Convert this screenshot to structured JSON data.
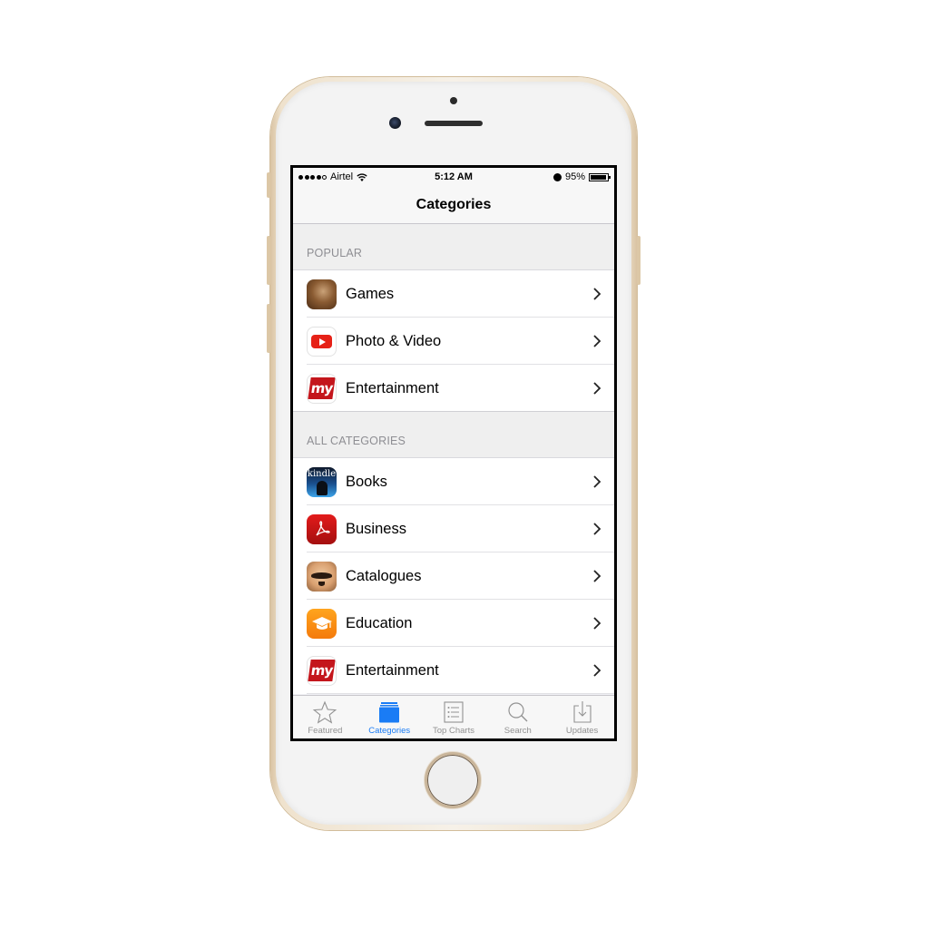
{
  "status_bar": {
    "carrier": "Airtel",
    "signal_bars_filled": 4,
    "signal_bars_total": 5,
    "time": "5:12 AM",
    "battery_percent": "95%",
    "battery_level": 0.95,
    "icons": [
      "signal-icon",
      "wifi-icon",
      "alarm-icon",
      "battery-icon"
    ]
  },
  "nav": {
    "title": "Categories"
  },
  "sections": [
    {
      "header": "POPULAR",
      "items": [
        {
          "label": "Games",
          "icon": "games-app-icon"
        },
        {
          "label": "Photo & Video",
          "icon": "youtube-app-icon"
        },
        {
          "label": "Entertainment",
          "icon": "bookmyshow-app-icon"
        }
      ]
    },
    {
      "header": "ALL CATEGORIES",
      "items": [
        {
          "label": "Books",
          "icon": "kindle-app-icon"
        },
        {
          "label": "Business",
          "icon": "adobe-acrobat-app-icon"
        },
        {
          "label": "Catalogues",
          "icon": "catalogues-app-icon"
        },
        {
          "label": "Education",
          "icon": "education-app-icon"
        },
        {
          "label": "Entertainment",
          "icon": "bookmyshow-app-icon"
        }
      ]
    }
  ],
  "icon_text": {
    "kindle": "kindle",
    "bms": "my"
  },
  "tab_bar": {
    "active_color": "#1a7cf5",
    "inactive_color": "#929292",
    "tabs": [
      {
        "label": "Featured",
        "icon": "star-icon",
        "active": false
      },
      {
        "label": "Categories",
        "icon": "categories-icon",
        "active": true
      },
      {
        "label": "Top Charts",
        "icon": "list-icon",
        "active": false
      },
      {
        "label": "Search",
        "icon": "search-icon",
        "active": false
      },
      {
        "label": "Updates",
        "icon": "download-icon",
        "active": false
      }
    ]
  }
}
